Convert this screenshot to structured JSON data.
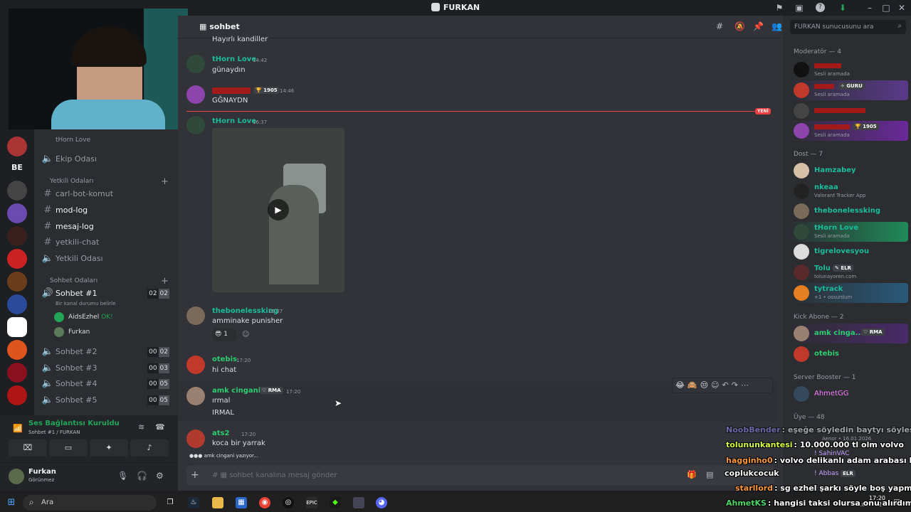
{
  "app": {
    "title": "FURKAN",
    "colors": {
      "bg": "#313338",
      "sidebar": "#2b2d31",
      "rail": "#1e1f22",
      "accent": "#5865f2",
      "new_line": "#f23f43",
      "online": "#23a559"
    }
  },
  "sidebar": {
    "streamer_row": "tHorn Love",
    "ekip": "Ekip Odası",
    "category_yetkili": "Yetkili Odaları",
    "channels_text": [
      "carl-bot-komut",
      "mod-log",
      "mesaj-log",
      "yetkili-chat",
      "Yetkili Odası"
    ],
    "category_sohbet": "Sohbet Odaları",
    "voice_active": {
      "name": "Sohbet #1",
      "status": "Bir kanal durumu belirle",
      "count_a": "02",
      "count_b": "02"
    },
    "voice_users": [
      {
        "name": "AidsEzhel",
        "tag": "OK!"
      },
      {
        "name": "Furkan"
      }
    ],
    "voice_channels": [
      {
        "name": "Sohbet #2",
        "a": "00",
        "b": "02"
      },
      {
        "name": "Sohbet #3",
        "a": "00",
        "b": "03"
      },
      {
        "name": "Sohbet #4",
        "a": "00",
        "b": "05"
      },
      {
        "name": "Sohbet #5",
        "a": "00",
        "b": "05"
      }
    ],
    "rail_label": "BE"
  },
  "voice_panel": {
    "status": "Ses Bağlantısı Kuruldu",
    "channel": "Sohbet #1 / FURKAN"
  },
  "user_panel": {
    "name": "Furkan",
    "status": "Görünmez"
  },
  "chat": {
    "channel": "sohbet",
    "new_label": "YENİ",
    "input_placeholder": "sohbet kanalına mesaj gönder",
    "typing": "amk cingani yazıyor...",
    "messages": [
      {
        "text": "Hayırlı kandiller"
      },
      {
        "author": "tHorn Love",
        "time": "14:42",
        "text": "günaydın"
      },
      {
        "author": "",
        "badge": "1905",
        "time": "14:46",
        "text": "GĞNAYDN"
      },
      {
        "author": "tHorn Love",
        "time": "16:37"
      },
      {
        "author": "thebonelessking",
        "time": "16:37",
        "text": "amminake punisher",
        "reaction_count": "1"
      },
      {
        "author": "otebis",
        "time": "17:20",
        "text": "hi chat"
      },
      {
        "author": "amk cingani",
        "badge": "RMA",
        "time": "17:20",
        "text": "ırmal",
        "text2": "IRMAL"
      },
      {
        "author": "ats2",
        "time": "17:20",
        "text": "koca bir yarrak"
      }
    ]
  },
  "members": {
    "search_placeholder": "FURKAN sunucusunu ara",
    "groups": [
      {
        "label": "Moderatör — 4"
      },
      {
        "label": "Dost — 7"
      },
      {
        "label": "Kick Abone — 2"
      },
      {
        "label": "Server Booster — 1"
      },
      {
        "label": "Üye — 48"
      }
    ],
    "moderators": [
      {
        "status": "Sesli aramada"
      },
      {
        "badge": "GURU",
        "status": "Sesli aramada"
      },
      {},
      {
        "badge": "1905",
        "status": "Sesli aramada"
      }
    ],
    "dost": [
      {
        "name": "Hamzabey"
      },
      {
        "name": "nkeaa",
        "status": "Valorant Tracker App"
      },
      {
        "name": "thebonelessking"
      },
      {
        "name": "tHorn Love",
        "status": "Sesli aramada"
      },
      {
        "name": "tigrelovesyou"
      },
      {
        "name": "Tolu",
        "badge": "ELR",
        "status": "tolunayoren.com"
      },
      {
        "name": "tytrack",
        "status": "+1 • ossurdum"
      }
    ],
    "kick": [
      {
        "name": "amk cinga...",
        "badge": "RMA"
      },
      {
        "name": "otebis"
      }
    ],
    "booster": [
      {
        "name": "AhmetGG"
      }
    ],
    "uye_partial": [
      {
        "name": "Aenor • 16.01.2026"
      },
      {
        "name": "! SahinVAC"
      },
      {
        "name": "! Abbas",
        "badge": "ELR"
      }
    ]
  },
  "stream_chat": [
    {
      "user": "NoobBender",
      "text": ": eşeğe söyledin baytyı söylesin",
      "color": "#9b8cff"
    },
    {
      "user": "tolununkantesi",
      "text": ": 10.000.000 tl olm volvo",
      "color": "#d6ff3b"
    },
    {
      "user": "hagginho0",
      "text": ": volvo delikanlı adam arabası bmw",
      "color": "#ff9a3b"
    },
    {
      "user": "",
      "text": "coplukcocuk",
      "color": "#ffffff"
    },
    {
      "user": "starllord",
      "text": ": sg ezhel şarkı söyle boş yapma",
      "color": "#ff9a3b"
    },
    {
      "user": "AhmetKS",
      "text": ": hangisi taksi olursa onu alırdım",
      "color": "#4cd964"
    }
  ],
  "taskbar": {
    "search": "Ara",
    "clock_time": "17:20",
    "clock_date": "1.09.2025"
  }
}
